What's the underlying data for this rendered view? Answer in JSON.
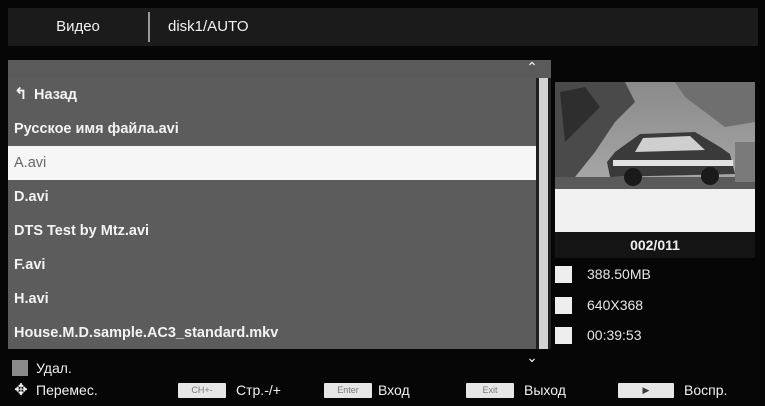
{
  "header": {
    "tab_label": "Видео",
    "path": "disk1/AUTO"
  },
  "file_list": {
    "items": [
      {
        "label": "Назад",
        "icon": "back-arrow-icon"
      },
      {
        "label": "Русское имя файла.avi"
      },
      {
        "label": "A.avi",
        "selected": true
      },
      {
        "label": "D.avi"
      },
      {
        "label": "DTS Test by Mtz.avi"
      },
      {
        "label": "F.avi"
      },
      {
        "label": "H.avi"
      },
      {
        "label": "House.M.D.sample.AC3_standard.mkv"
      }
    ]
  },
  "scroll": {
    "up_glyph": "⌃",
    "down_glyph": "⌄"
  },
  "info": {
    "counter": "002/011",
    "size": "388.50MB",
    "resolution": "640X368",
    "duration": "00:39:53"
  },
  "delete": {
    "label": "Удал."
  },
  "footer": {
    "move_label": "Перемес.",
    "page_key": "CH+-",
    "page_label": "Стр.-/+",
    "enter_key": "Enter",
    "enter_label": "Вход",
    "exit_key": "Exit",
    "exit_label": "Выход",
    "play_key_glyph": "▶",
    "play_label": "Воспр."
  },
  "colors": {
    "list_bg": "#5c5c5c",
    "selected_bg": "#f6f6f6",
    "header_bg": "#1b1b1b"
  }
}
